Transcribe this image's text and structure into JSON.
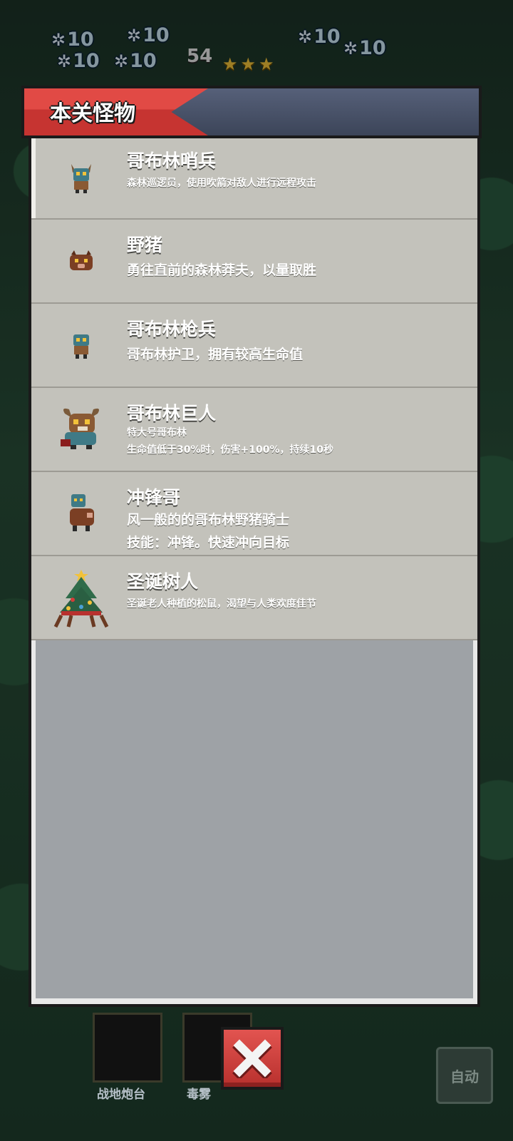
{
  "hud": {
    "numbers": [
      "10",
      "10",
      "10",
      "10",
      "10",
      "10",
      "10"
    ],
    "level_count": "54",
    "stars": "★★★"
  },
  "panel": {
    "title": "本关怪物",
    "monsters": [
      {
        "name": "哥布林哨兵",
        "description_lines": [
          "森林巡逻员，使用吹箭对敌人进行远程攻击"
        ],
        "text_size": "small",
        "icon": "goblin-sentry-icon"
      },
      {
        "name": "野猪",
        "description_lines": [
          "勇往直前的森林莽夫，以量取胜"
        ],
        "text_size": "large",
        "icon": "wild-boar-icon"
      },
      {
        "name": "哥布林枪兵",
        "description_lines": [
          "哥布林护卫，拥有较高生命值"
        ],
        "text_size": "large",
        "icon": "goblin-spearman-icon"
      },
      {
        "name": "哥布林巨人",
        "description_lines": [
          "特大号哥布林",
          "生命值低于30%时，伤害+100%，持续10秒"
        ],
        "text_size": "small",
        "icon": "goblin-giant-icon"
      },
      {
        "name": "冲锋哥",
        "description_lines": [
          "风一般的的哥布林野猪骑士",
          "技能：冲锋。快速冲向目标"
        ],
        "text_size": "large",
        "icon": "charge-goblin-icon"
      },
      {
        "name": "圣诞树人",
        "description_lines": [
          "圣诞老人种植的松鼠，渴望与人类欢度佳节"
        ],
        "text_size": "small",
        "icon": "christmas-treant-icon"
      }
    ]
  },
  "bottom": {
    "slot_labels": [
      "战地炮台",
      "毒雾"
    ],
    "auto_label": "自动",
    "close_icon": "close-x-icon"
  },
  "colors": {
    "banner_red": "#d63c38",
    "banner_blue": "#4a5369",
    "row_bg": "#c3c2bb",
    "panel_bg": "#9ea2a6"
  }
}
